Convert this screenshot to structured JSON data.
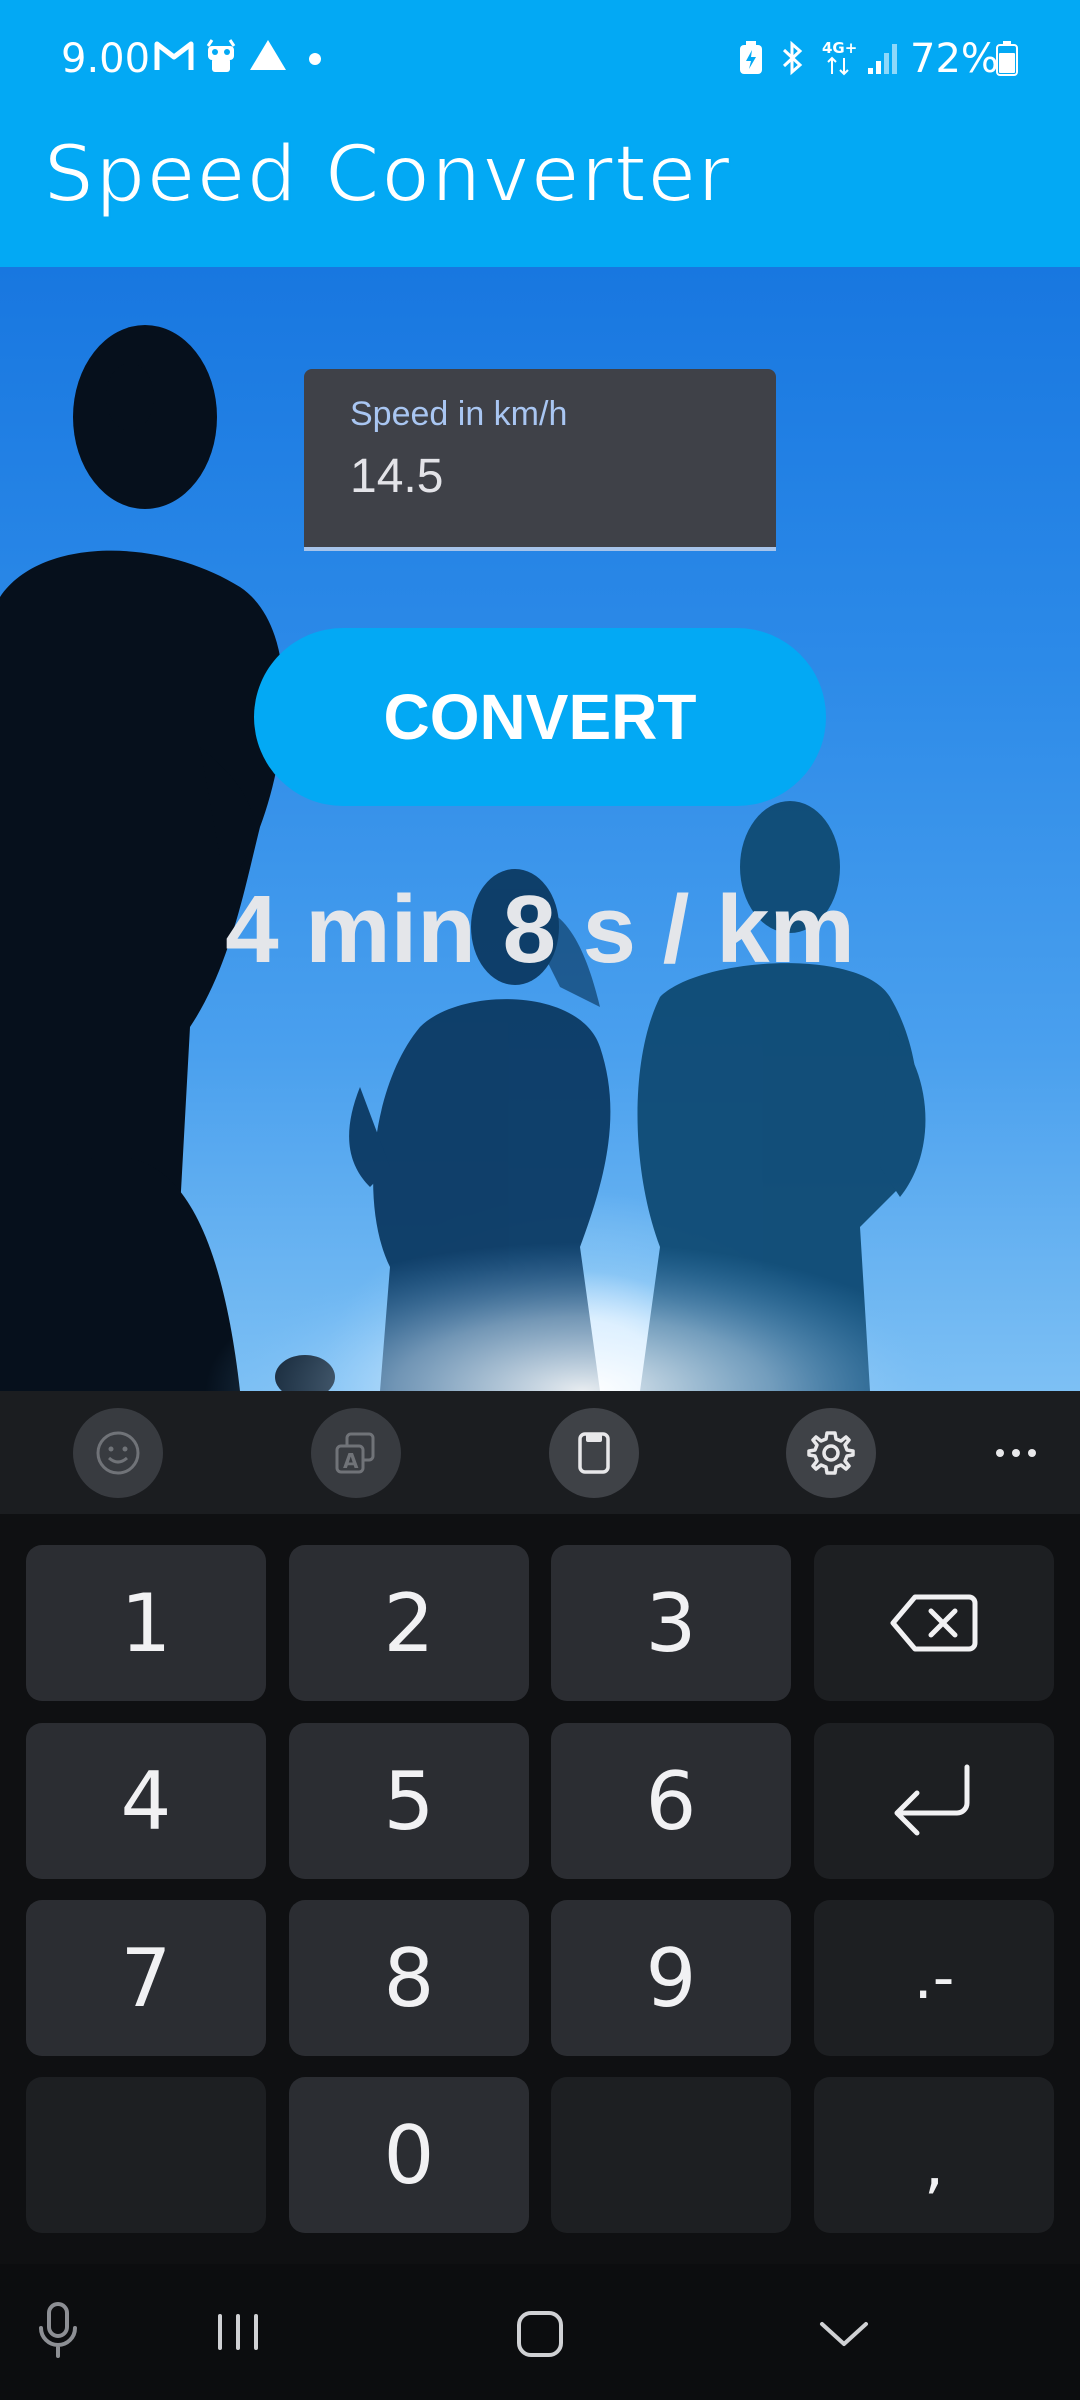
{
  "status_bar": {
    "time": "9.00",
    "battery_percent": "72%",
    "network": "4G+",
    "icons": [
      "gmail-icon",
      "notification-icon",
      "drive-icon",
      "dot-icon",
      "battery-saver-icon",
      "bluetooth-icon",
      "signal-icon",
      "battery-icon"
    ]
  },
  "app_bar": {
    "title": "Speed Converter",
    "color": "#03a9f4"
  },
  "form": {
    "speed_label": "Speed in km/h",
    "speed_value": "14.5",
    "convert_label": "CONVERT",
    "result": "4 min 8 s / km"
  },
  "keyboard": {
    "toolbar": [
      "emoji-icon",
      "translate-icon",
      "clipboard-icon",
      "settings-icon",
      "more-icon"
    ],
    "keys": [
      [
        "1",
        "2",
        "3",
        "⌫"
      ],
      [
        "4",
        "5",
        "6",
        "↵"
      ],
      [
        "7",
        "8",
        "9",
        ".-"
      ],
      [
        "",
        "0",
        "",
        ","
      ]
    ]
  },
  "nav_bar": [
    "mic-icon",
    "recents-icon",
    "home-icon",
    "hide-keyboard-icon"
  ]
}
